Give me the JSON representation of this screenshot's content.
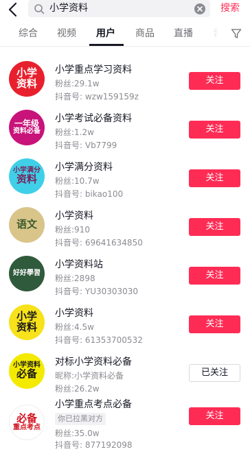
{
  "search": {
    "query": "小学资料",
    "action_label": "搜索"
  },
  "tabs": [
    {
      "label": "综合"
    },
    {
      "label": "视频"
    },
    {
      "label": "用户"
    },
    {
      "label": "商品"
    },
    {
      "label": "直播"
    },
    {
      "label": "音"
    }
  ],
  "active_tab": "用户",
  "colors": {
    "accent": "#fe2c55",
    "text_primary": "#161823",
    "text_secondary": "#8a8b91"
  },
  "results": [
    {
      "name": "小学重点学习资料",
      "line2": "粉丝:29.1w",
      "line3": "抖音号: wzw159159z",
      "button": "关注",
      "avatar": {
        "lines": [
          "小学",
          "资料"
        ],
        "bg": "#e8202e",
        "fg": "#ffffff"
      }
    },
    {
      "name": "小学考试必备资料",
      "line2": "粉丝:1.2w",
      "line3": "抖音号: Vb7799",
      "button": "关注",
      "avatar": {
        "lines": [
          "一年级",
          "资料必备"
        ],
        "bg": "#c8137a",
        "fg": "#ffffff"
      }
    },
    {
      "name": "小学满分资料",
      "line2": "粉丝:10.7w",
      "line3": "抖音号: bikao100",
      "button": "关注",
      "avatar": {
        "lines": [
          "小学满分",
          "资料"
        ],
        "bg": "#3fd0e8",
        "fg": "#7a1f5c"
      }
    },
    {
      "name": "小学资料",
      "line2": "粉丝:910",
      "line3": "抖音号: 69641634850",
      "button": "关注",
      "avatar": {
        "lines": [
          "语文"
        ],
        "bg": "#d9c58a",
        "fg": "#3a5a2a"
      }
    },
    {
      "name": "小学资料站",
      "line2": "粉丝:2898",
      "line3": "抖音号: YU30303030",
      "button": "关注",
      "avatar": {
        "lines": [
          "好好學習"
        ],
        "bg": "#2f5a3c",
        "fg": "#ffffff"
      }
    },
    {
      "name": "小学资料",
      "line2": "粉丝:4.5w",
      "line3": "抖音号: 61353700532",
      "button": "关注",
      "avatar": {
        "lines": [
          "小学",
          "资料"
        ],
        "bg": "#f7e21b",
        "fg": "#1a1a1a"
      }
    },
    {
      "name": "对标小学资料必备",
      "line2": "昵称:小学资料必备",
      "line3": "粉丝:26.2w",
      "button": "已关注",
      "followed": true,
      "avatar": {
        "lines": [
          "小学资料",
          "必备"
        ],
        "bg": "#f4ea00",
        "fg": "#1a1a1a"
      }
    },
    {
      "name": "小学重点考点必备",
      "tag": "你已拉黑对方",
      "line2": "粉丝:35.0w",
      "line3": "抖音号: 877192098",
      "button": "关注",
      "avatar": {
        "lines": [
          "必备",
          "重点考点"
        ],
        "bg": "#ffffff",
        "fg": "#d1121f"
      }
    }
  ]
}
